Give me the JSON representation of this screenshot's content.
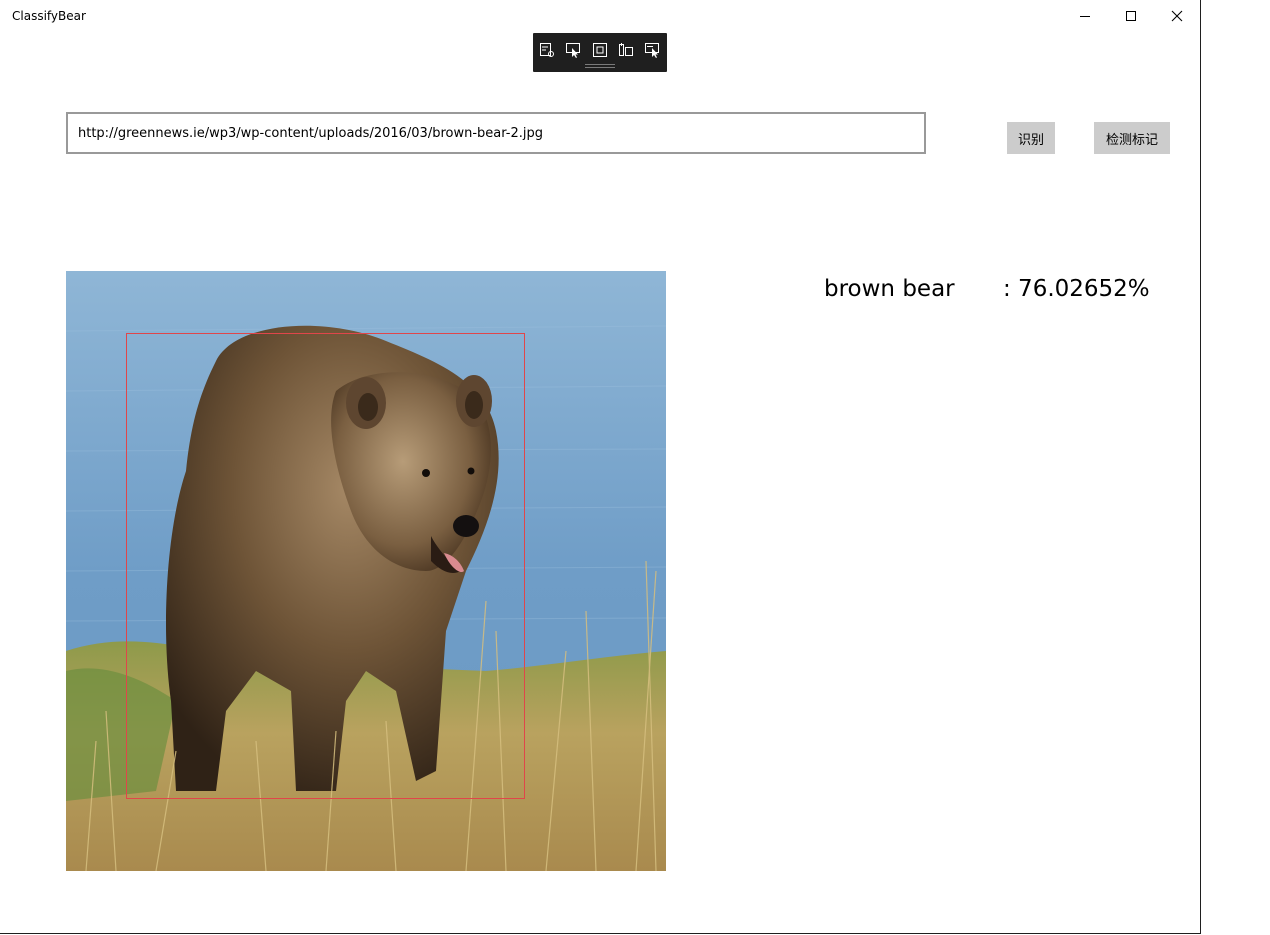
{
  "window": {
    "title": "ClassifyBear",
    "caption_buttons": [
      "minimize-icon",
      "maximize-icon",
      "close-icon"
    ]
  },
  "debug_toolbar": {
    "icons": [
      "live-visual-tree-icon",
      "select-element-icon",
      "display-layout-adorners-icon",
      "track-focus-icon",
      "select-element-hover-icon"
    ]
  },
  "url_input": {
    "value": "http://greennews.ie/wp3/wp-content/uploads/2016/03/brown-bear-2.jpg"
  },
  "buttons": {
    "classify_label": "识别",
    "detect_label": "检测标记"
  },
  "image": {
    "subject": "brown bear standing on grass by water",
    "bounding_box_color": "#e0464a"
  },
  "result": {
    "label": "brown bear",
    "score": ": 76.02652%"
  }
}
